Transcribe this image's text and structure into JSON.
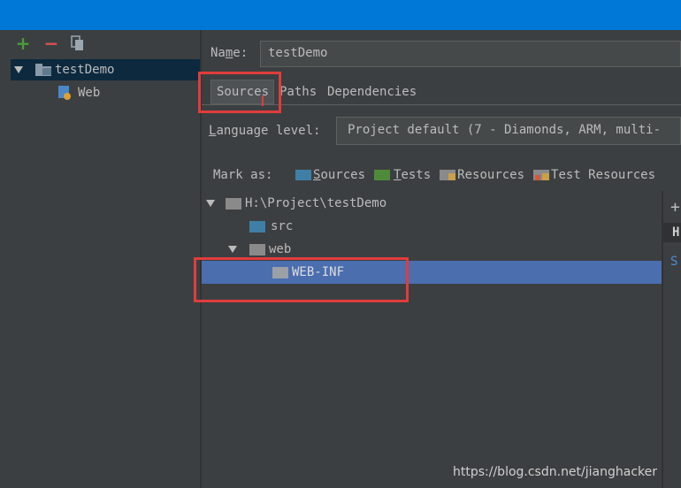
{
  "left": {
    "add_label": "+",
    "remove_label": "−",
    "tree": [
      {
        "label": "testDemo",
        "icon": "module-folder-icon"
      },
      {
        "label": "Web",
        "icon": "web-facet-icon"
      }
    ]
  },
  "name": {
    "label_pre": "Na",
    "label_mn": "m",
    "label_post": "e:",
    "value": "testDemo"
  },
  "tabs": [
    {
      "label": "Sources",
      "active": true
    },
    {
      "label": "Paths",
      "active": false
    },
    {
      "label": "Dependencies",
      "active": false
    }
  ],
  "language": {
    "label_u": "L",
    "label_rest": "anguage level:",
    "value": "Project default (7 - Diamonds, ARM, multi-"
  },
  "mark_as": {
    "label": "Mark as:",
    "items": [
      {
        "u": "S",
        "rest": "ources",
        "color": "#3f7fa6"
      },
      {
        "u": "T",
        "rest": "ests",
        "color": "#4f8a3a"
      },
      {
        "u": "",
        "rest": "Resources",
        "color": "#8a8a8a"
      },
      {
        "u": "",
        "rest": "Test Resources",
        "color": "#8a8a8a"
      }
    ]
  },
  "content_tree": [
    {
      "label": "H:\\Project\\testDemo",
      "expanded": true
    },
    {
      "label": "src"
    },
    {
      "label": "web",
      "expanded": true
    },
    {
      "label": "WEB-INF",
      "selected": true
    }
  ],
  "side": {
    "plus": "+",
    "h_label": "H",
    "s_label": "S"
  },
  "watermark": "https://blog.csdn.net/jianghacker",
  "colors": {
    "titlebar": "#0078d7",
    "selection": "#4b6eaf",
    "highlight": "#e03c3c"
  }
}
